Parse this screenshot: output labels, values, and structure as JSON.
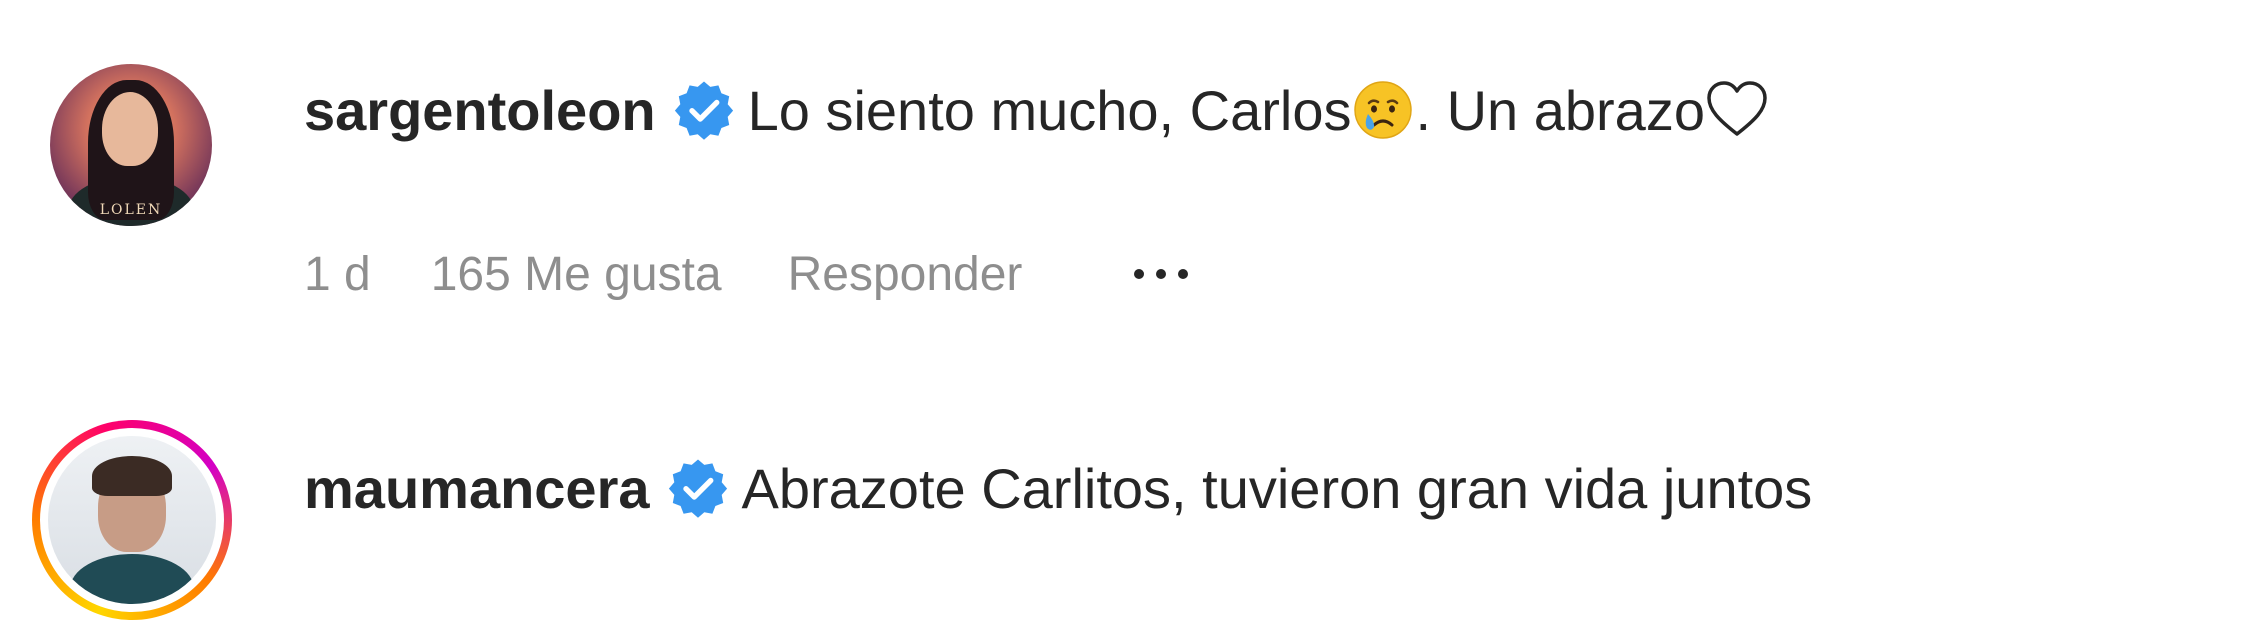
{
  "comments": [
    {
      "username": "sargentoleon",
      "verified": true,
      "text_before_emoji": "Lo siento mucho, Carlos",
      "emoji": "crying-face",
      "text_after_emoji": ". Un abrazo",
      "trailing_emoji": "white-heart",
      "time": "1 d",
      "likes": "165 Me gusta",
      "reply_label": "Responder",
      "avatar_logo_text": "LOLEN"
    },
    {
      "username": "maumancera",
      "verified": true,
      "text": "Abrazote Carlitos, tuvieron gran vida juntos"
    }
  ],
  "colors": {
    "text": "#262626",
    "secondary_text": "#8e8e8e",
    "verified_badge": "#3797f0",
    "story_ring_start": "#ffd600",
    "story_ring_mid": "#ff0169",
    "story_ring_end": "#d300c5"
  },
  "icons": {
    "verified": "verified-badge-icon",
    "more": "more-options-icon",
    "crying_emoji": "crying-face-emoji",
    "heart_emoji": "white-heart-emoji"
  }
}
